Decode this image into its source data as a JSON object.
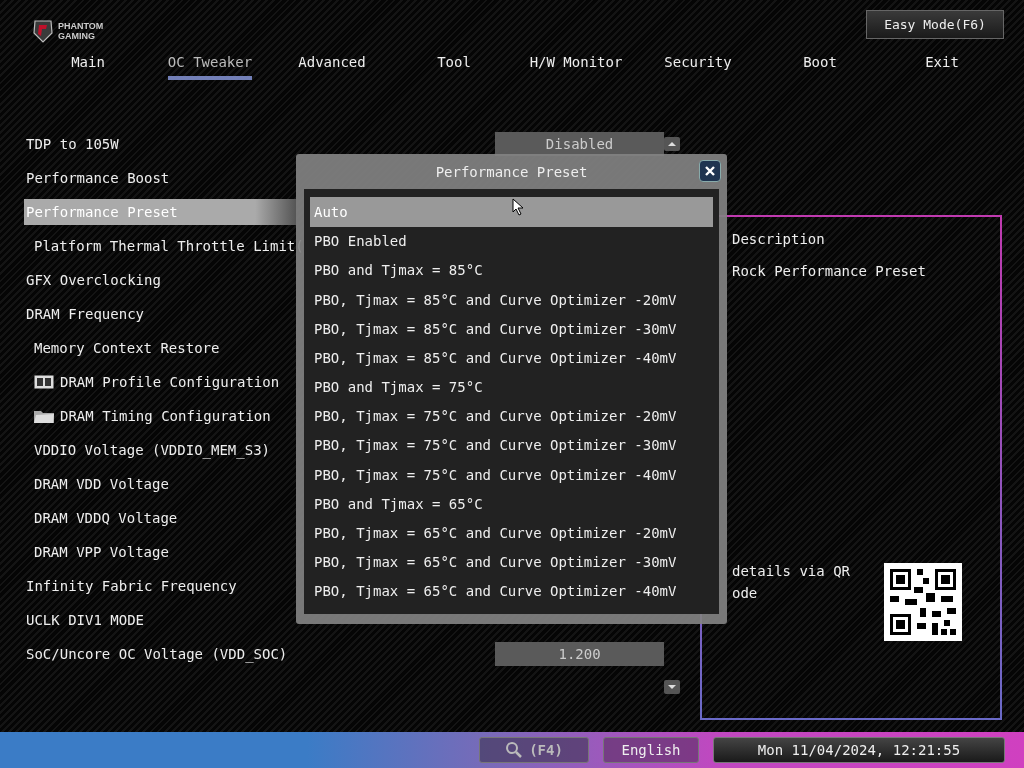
{
  "logo": {
    "line_1": "PHANTOM",
    "line_2": "GAMING"
  },
  "easy_mode_button": "Easy Mode(F6)",
  "tabs": [
    {
      "label": "Main",
      "selected": false
    },
    {
      "label": "OC Tweaker",
      "selected": true
    },
    {
      "label": "Advanced",
      "selected": false
    },
    {
      "label": "Tool",
      "selected": false
    },
    {
      "label": "H/W Monitor",
      "selected": false
    },
    {
      "label": "Security",
      "selected": false
    },
    {
      "label": "Boot",
      "selected": false
    },
    {
      "label": "Exit",
      "selected": false
    }
  ],
  "settings": [
    {
      "label": "TDP to 105W",
      "kind": "plain",
      "indented": false,
      "selected": false,
      "value": "Disabled"
    },
    {
      "label": "Performance Boost",
      "kind": "plain",
      "indented": false,
      "selected": false
    },
    {
      "label": "Performance Preset",
      "kind": "plain",
      "indented": false,
      "selected": true
    },
    {
      "label": "Platform Thermal Throttle Limit(",
      "kind": "plain",
      "indented": true,
      "selected": false
    },
    {
      "label": "GFX Overclocking",
      "kind": "plain",
      "indented": false,
      "selected": false
    },
    {
      "label": "DRAM Frequency",
      "kind": "plain",
      "indented": false,
      "selected": false
    },
    {
      "label": "Memory Context Restore",
      "kind": "plain",
      "indented": true,
      "selected": false
    },
    {
      "label": "DRAM Profile Configuration",
      "kind": "book",
      "indented": true,
      "selected": false
    },
    {
      "label": "DRAM Timing Configuration",
      "kind": "folder",
      "indented": true,
      "selected": false
    },
    {
      "label": "VDDIO Voltage (VDDIO_MEM_S3)",
      "kind": "plain",
      "indented": true,
      "selected": false
    },
    {
      "label": "DRAM VDD Voltage",
      "kind": "plain",
      "indented": true,
      "selected": false
    },
    {
      "label": "DRAM VDDQ Voltage",
      "kind": "plain",
      "indented": true,
      "selected": false
    },
    {
      "label": "DRAM VPP Voltage",
      "kind": "plain",
      "indented": true,
      "selected": false
    },
    {
      "label": "Infinity Fabric Frequency",
      "kind": "plain",
      "indented": false,
      "selected": false
    },
    {
      "label": "UCLK DIV1 MODE",
      "kind": "plain",
      "indented": false,
      "selected": false
    },
    {
      "label": "SoC/Uncore OC Voltage (VDD_SOC)",
      "kind": "plain",
      "indented": false,
      "selected": false,
      "value": "1.200"
    }
  ],
  "description": {
    "title": "Description",
    "text": "Rock Performance Preset",
    "qr_text_1": "details via QR",
    "qr_text_2": "ode"
  },
  "popup": {
    "title": "Performance Preset",
    "options": [
      {
        "label": "Auto",
        "selected": true
      },
      {
        "label": "PBO Enabled",
        "selected": false
      },
      {
        "label": "PBO and Tjmax = 85°C",
        "selected": false
      },
      {
        "label": "PBO, Tjmax = 85°C and Curve Optimizer -20mV",
        "selected": false
      },
      {
        "label": "PBO, Tjmax = 85°C and Curve Optimizer -30mV",
        "selected": false
      },
      {
        "label": "PBO, Tjmax = 85°C and Curve Optimizer -40mV",
        "selected": false
      },
      {
        "label": "PBO and Tjmax = 75°C",
        "selected": false
      },
      {
        "label": "PBO, Tjmax = 75°C and Curve Optimizer -20mV",
        "selected": false
      },
      {
        "label": "PBO, Tjmax = 75°C and Curve Optimizer -30mV",
        "selected": false
      },
      {
        "label": "PBO, Tjmax = 75°C and Curve Optimizer -40mV",
        "selected": false
      },
      {
        "label": "PBO and Tjmax = 65°C",
        "selected": false
      },
      {
        "label": "PBO, Tjmax = 65°C and Curve Optimizer -20mV",
        "selected": false
      },
      {
        "label": "PBO, Tjmax = 65°C and Curve Optimizer -30mV",
        "selected": false
      },
      {
        "label": "PBO, Tjmax = 65°C and Curve Optimizer -40mV",
        "selected": false
      }
    ]
  },
  "status_bar": {
    "search_key": "(F4)",
    "language": "English",
    "datetime": "Mon 11/04/2024, 12:21:55"
  }
}
